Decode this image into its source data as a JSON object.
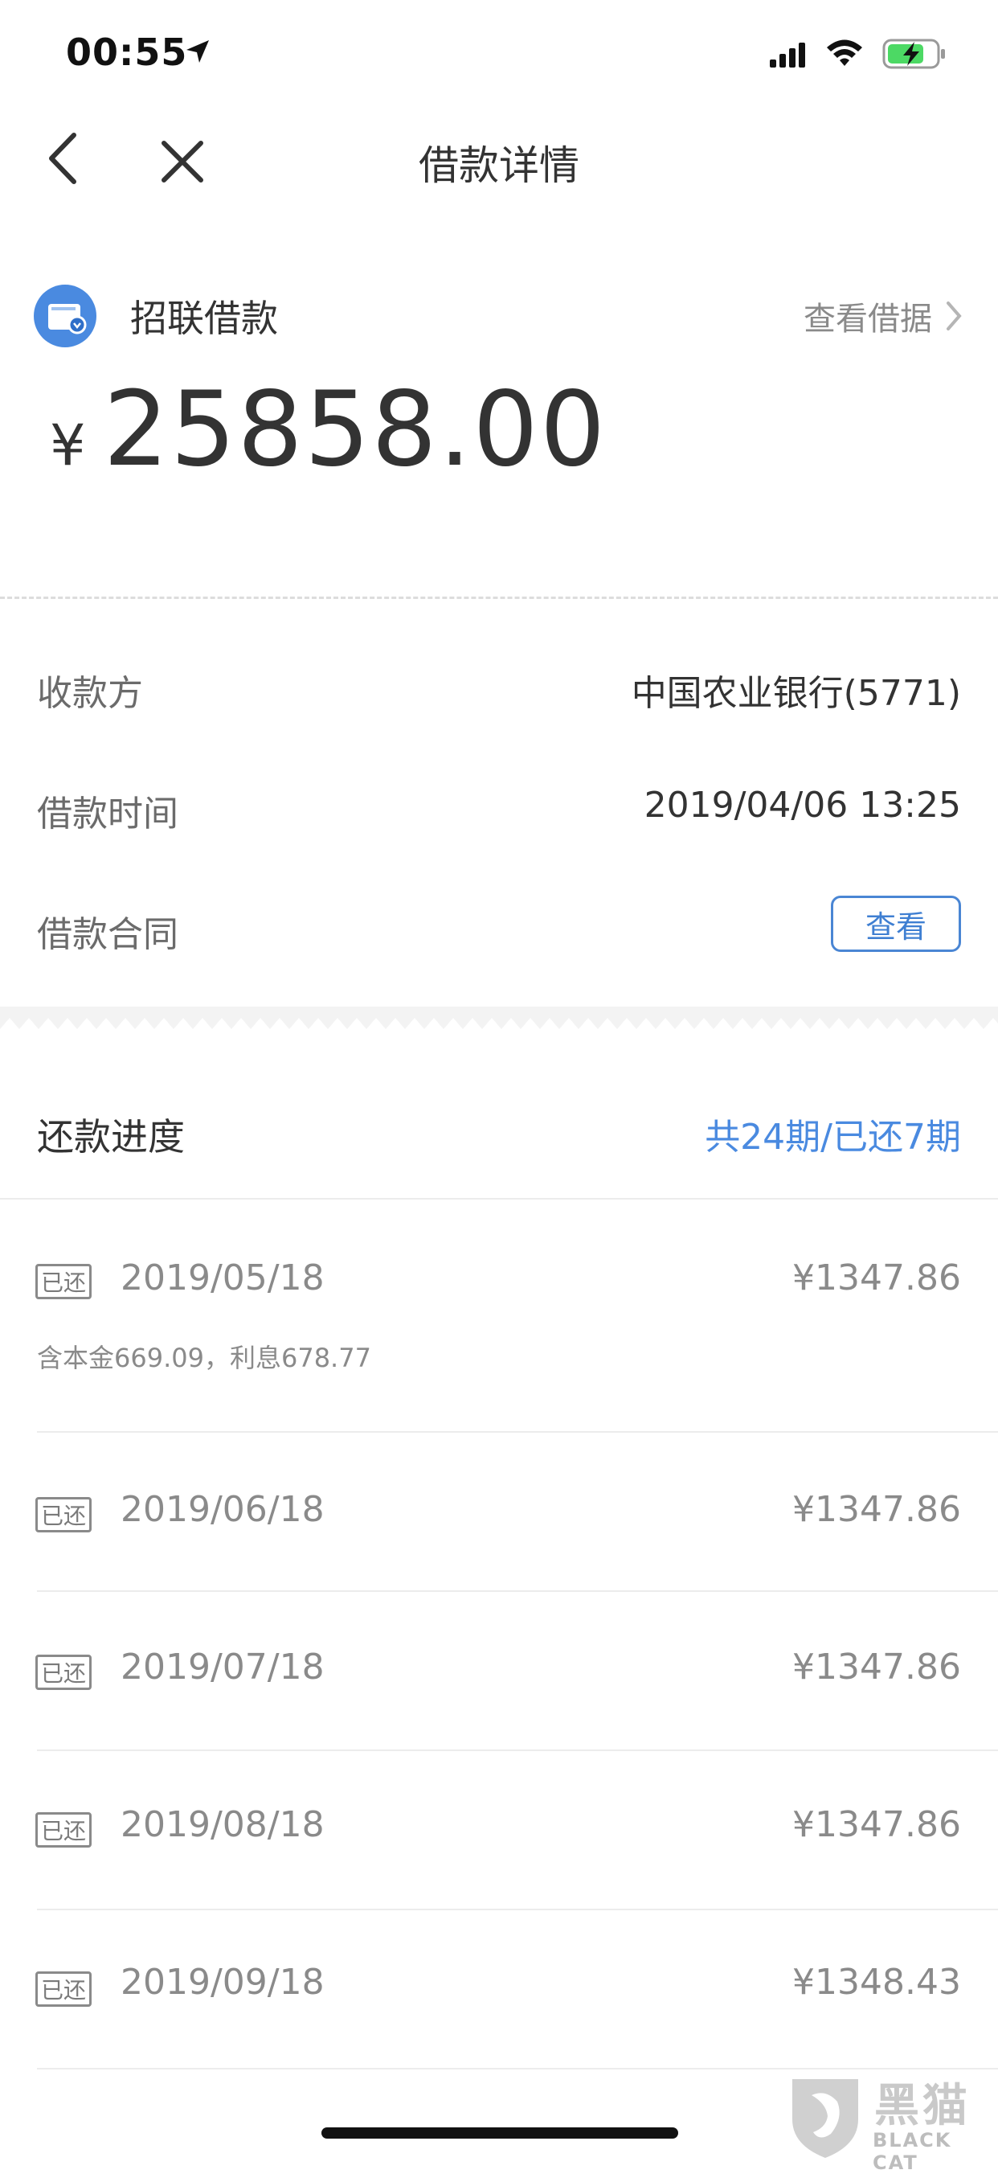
{
  "status_bar": {
    "time": "00:55"
  },
  "nav": {
    "title": "借款详情"
  },
  "loan": {
    "name": "招联借款",
    "view_receipt_label": "查看借据",
    "currency": "¥",
    "amount": "25858.00"
  },
  "details": {
    "payee_label": "收款方",
    "payee_value": "中国农业银行(5771)",
    "time_label": "借款时间",
    "time_value": "2019/04/06 13:25",
    "contract_label": "借款合同",
    "contract_button": "查看"
  },
  "progress": {
    "title": "还款进度",
    "summary": "共24期/已还7期"
  },
  "payments": [
    {
      "badge": "已还",
      "date": "2019/05/18",
      "amount": "¥1347.86",
      "note": "含本金669.09，利息678.77"
    },
    {
      "badge": "已还",
      "date": "2019/06/18",
      "amount": "¥1347.86"
    },
    {
      "badge": "已还",
      "date": "2019/07/18",
      "amount": "¥1347.86"
    },
    {
      "badge": "已还",
      "date": "2019/08/18",
      "amount": "¥1347.86"
    },
    {
      "badge": "已还",
      "date": "2019/09/18",
      "amount": "¥1348.43"
    }
  ],
  "watermark": {
    "text": "黑猫",
    "sub": "BLACK CAT"
  },
  "colors": {
    "accent": "#4a8ae0",
    "text": "#333333",
    "muted": "#8a8a8a"
  }
}
